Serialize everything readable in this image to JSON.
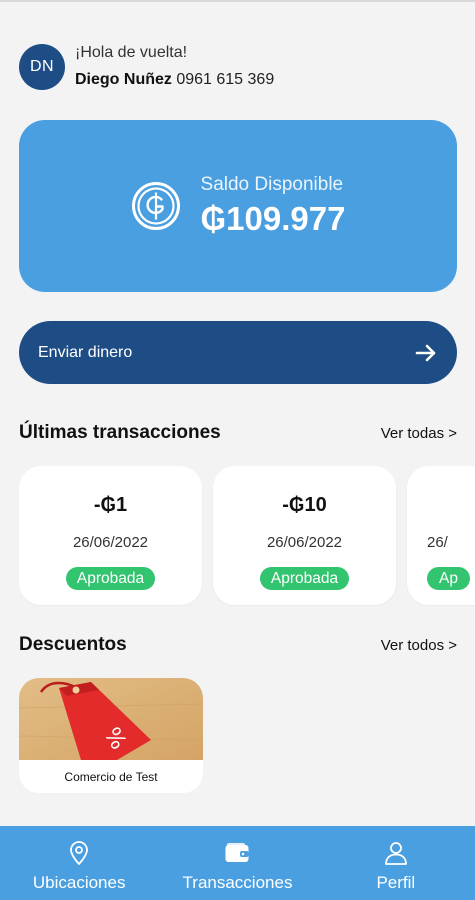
{
  "user": {
    "initials": "DN",
    "greeting": "¡Hola de vuelta!",
    "name": "Diego Nuñez",
    "phone": "0961 615 369"
  },
  "balance": {
    "label": "Saldo Disponible",
    "amount": "₲109.977",
    "icon": "guarani-coin-icon"
  },
  "send": {
    "label": "Enviar dinero",
    "icon": "arrow-right-icon"
  },
  "transactions": {
    "title": "Últimas transacciones",
    "link": "Ver todas >",
    "items": [
      {
        "amount": "-₲1",
        "date": "26/06/2022",
        "status": "Aprobada"
      },
      {
        "amount": "-₲10",
        "date": "26/06/2022",
        "status": "Aprobada"
      },
      {
        "amount": "",
        "date": "26/",
        "status": "Ap"
      }
    ]
  },
  "discounts": {
    "title": "Descuentos",
    "link": "Ver todos >",
    "items": [
      {
        "name": "Comercio de Test",
        "image": "discount-tag-image"
      }
    ]
  },
  "nav": {
    "items": [
      {
        "label": "Ubicaciones",
        "icon": "location-pin-icon"
      },
      {
        "label": "Transacciones",
        "icon": "wallet-icon"
      },
      {
        "label": "Perfil",
        "icon": "user-icon"
      }
    ]
  },
  "colors": {
    "primary_light": "#4a9fe0",
    "primary_dark": "#1e4d86",
    "success": "#33c46f",
    "background": "#f3f3f4"
  }
}
